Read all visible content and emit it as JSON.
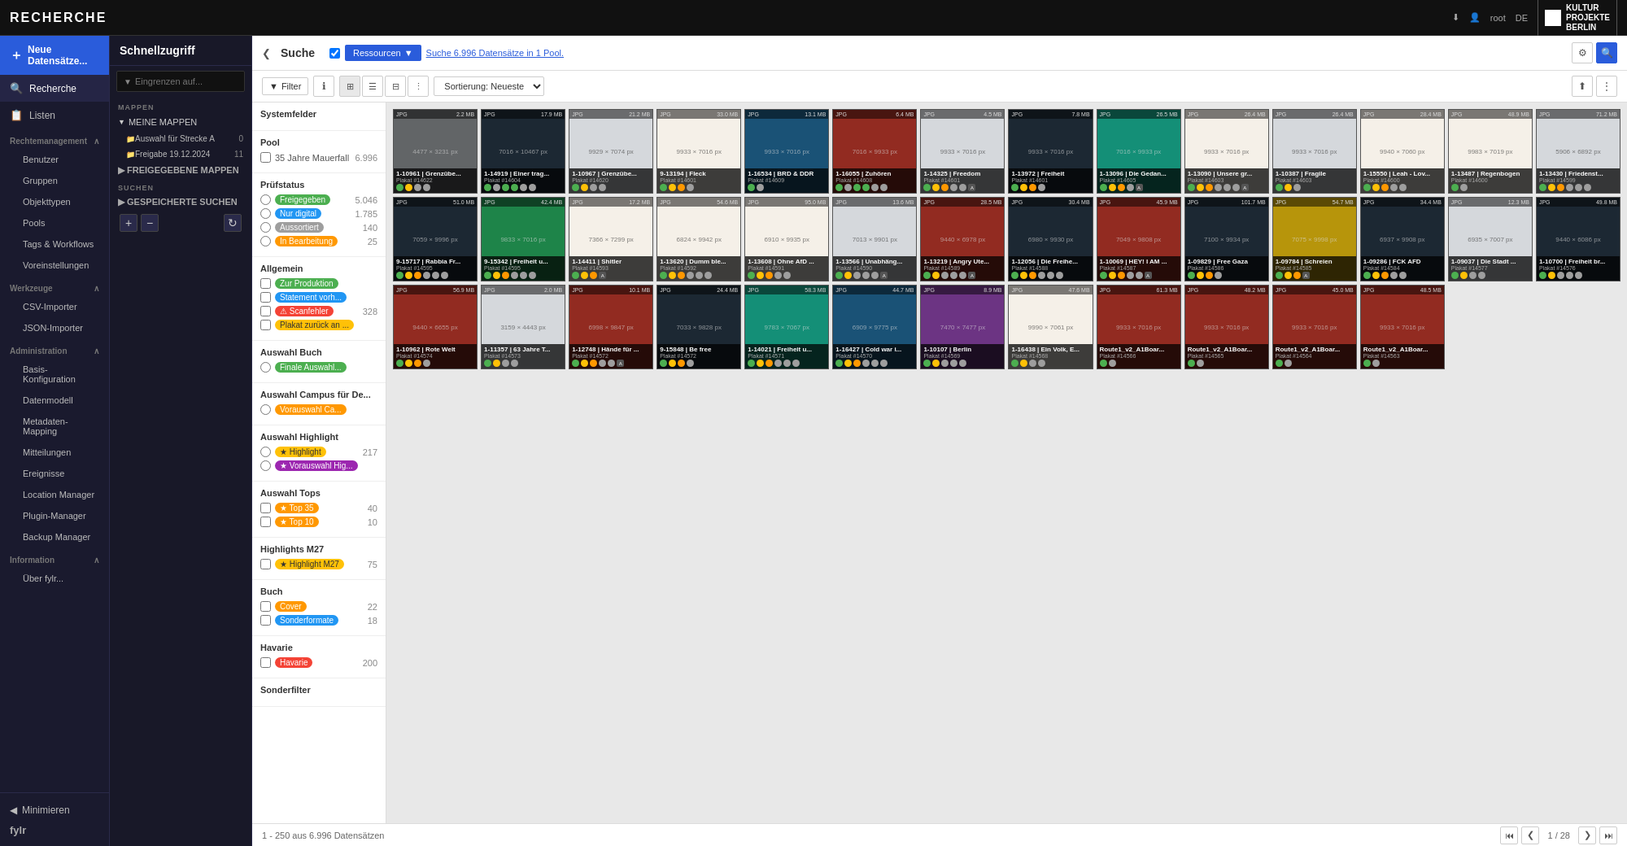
{
  "topbar": {
    "title": "RECHERCHE",
    "user": "root",
    "lang": "DE",
    "logo_line1": "KULTUR",
    "logo_line2": "PROJEKTE",
    "logo_line3": "BERLIN",
    "download_icon": "⬇",
    "user_icon": "👤"
  },
  "sidebar": {
    "new_btn": "Neue Datensätze...",
    "items": [
      {
        "id": "recherche",
        "label": "Recherche",
        "icon": "🔍",
        "active": true
      },
      {
        "id": "listen",
        "label": "Listen",
        "icon": "📋"
      }
    ],
    "sections": [
      {
        "label": "Rechtemanagement",
        "expanded": true,
        "sub": [
          "Benutzer",
          "Gruppen",
          "Objekttypen",
          "Pools",
          "Tags & Workflows",
          "Voreinstellungen"
        ]
      },
      {
        "label": "Werkzeuge",
        "expanded": true,
        "sub": [
          "CSV-Importer",
          "JSON-Importer"
        ]
      },
      {
        "label": "Administration",
        "expanded": true,
        "sub": [
          "Basis-Konfiguration",
          "Datenmodell",
          "Metadaten-Mapping",
          "Mitteilungen",
          "Ereignisse",
          "Location Manager",
          "Plugin-Manager",
          "Backup Manager"
        ]
      },
      {
        "label": "Information",
        "expanded": true,
        "sub": [
          "Über fylr..."
        ]
      }
    ],
    "minimize": "Minimieren",
    "logo": "fylr"
  },
  "quick_panel": {
    "title": "Schnellzugriff",
    "search_placeholder": "Eingrenzen auf...",
    "sections": {
      "mappen_label": "MAPPEN",
      "meine_mappen": "MEINE MAPPEN",
      "mappen_items": [
        {
          "label": "Auswahl für Strecke A",
          "count": "0"
        },
        {
          "label": "Freigabe 19.12.2024",
          "count": "11"
        }
      ],
      "freigegebene_mappen": "FREIGEGEBENE MAPPEN",
      "suchen_label": "SUCHEN",
      "gespeicherte_suchen": "GESPEICHERTE SUCHEN"
    }
  },
  "search": {
    "collapse_icon": "❮",
    "title": "Suche",
    "ressourcen_label": "Ressourcen",
    "search_info": "Suche 6.996 Datensätze in 1 Pool.",
    "filter_label": "Filter",
    "sort_label": "Sortierung: Neueste",
    "view_modes": [
      "⊞",
      "☰",
      "⊟",
      "⋮"
    ],
    "result_count": "1 - 250 aus 6.996 Datensätzen",
    "page": "1 / 28"
  },
  "filter_panel": {
    "system_fields": "Systemfelder",
    "pool_label": "Pool",
    "pool_item": "35 Jahre Mauerfall",
    "pool_count": "6.996",
    "pruefstatus_label": "Prüfstatus",
    "pruefstatus_items": [
      {
        "label": "Freigegeben",
        "color": "green",
        "count": "5.046"
      },
      {
        "label": "Nur digital",
        "color": "blue",
        "count": "1.785"
      },
      {
        "label": "Aussortiert",
        "color": "gray",
        "count": "140"
      },
      {
        "label": "In Bearbeitung",
        "color": "orange",
        "count": "25"
      }
    ],
    "allgemein_label": "Allgemein",
    "allgemein_items": [
      {
        "label": "Zur Produktion",
        "color": "green"
      },
      {
        "label": "Statement vorh...",
        "color": "blue"
      },
      {
        "label": "Scanfehler",
        "color": "red",
        "count": "328"
      },
      {
        "label": "Plakat zurück an ...",
        "color": "yellow"
      }
    ],
    "auswahl_buch_label": "Auswahl Buch",
    "auswahl_buch_items": [
      {
        "label": "Finale Auswahl...",
        "color": "green"
      }
    ],
    "auswahl_campus_label": "Auswahl Campus für De...",
    "auswahl_campus_items": [
      {
        "label": "Vorauswahl Ca...",
        "color": "orange"
      }
    ],
    "auswahl_highlight_label": "Auswahl Highlight",
    "auswahl_highlight_items": [
      {
        "label": "Highlight",
        "color": "yellow",
        "count": "217"
      },
      {
        "label": "Vorauswahl Hig...",
        "color": "purple"
      }
    ],
    "auswahl_tops_label": "Auswahl Tops",
    "auswahl_tops_items": [
      {
        "label": "Top 35",
        "color": "orange",
        "count": "40"
      },
      {
        "label": "Top 10",
        "color": "orange",
        "count": "10"
      }
    ],
    "highlights_m27_label": "Highlights M27",
    "highlights_m27_items": [
      {
        "label": "Highlight M27",
        "color": "yellow",
        "count": "75"
      }
    ],
    "buch_label": "Buch",
    "buch_items": [
      {
        "label": "Cover",
        "color": "orange",
        "count": "22"
      },
      {
        "label": "Sonderformate",
        "color": "blue",
        "count": "18"
      }
    ],
    "havarie_label": "Havarie",
    "havarie_items": [
      {
        "label": "Havarie",
        "color": "red",
        "count": "200"
      }
    ],
    "sonderfilter_label": "Sonderfilter"
  },
  "grid": {
    "items": [
      {
        "id": "1",
        "type": "JPG",
        "dims": "4477 × 3231 px",
        "size": "2.2 MB",
        "title": "1-10961 | Grenzübe...",
        "plakatNr": "Plakat #14622",
        "bg": "bg-gray",
        "icons": [
          "green",
          "yellow",
          "gray",
          "gray"
        ]
      },
      {
        "id": "2",
        "type": "JPG",
        "dims": "7016 × 10467 px",
        "size": "17.9 MB",
        "title": "1-14919 | Einer trag...",
        "plakatNr": "Plakat #14604",
        "bg": "bg-dark",
        "icons": [
          "green",
          "gray",
          "green",
          "green",
          "gray",
          "gray"
        ]
      },
      {
        "id": "3",
        "type": "JPG",
        "dims": "9929 × 7074 px",
        "size": "21.2 MB",
        "title": "1-10967 | Grenzübe...",
        "plakatNr": "Plakat #14620",
        "bg": "bg-light",
        "icons": [
          "green",
          "yellow",
          "gray",
          "gray"
        ]
      },
      {
        "id": "4",
        "type": "JPG",
        "dims": "9933 × 7016 px",
        "size": "33.0 MB",
        "title": "9-13194 | Fleck",
        "plakatNr": "Plakat #14601",
        "bg": "bg-cream",
        "icons": [
          "green",
          "yellow",
          "orange",
          "gray"
        ]
      },
      {
        "id": "5",
        "type": "JPG",
        "dims": "9933 × 7016 px",
        "size": "13.1 MB",
        "title": "1-16534 | BRD & DDR",
        "plakatNr": "Plakat #14609",
        "bg": "bg-blue",
        "icons": [
          "green",
          "gray"
        ]
      },
      {
        "id": "6",
        "type": "JPG",
        "dims": "7016 × 9933 px",
        "size": "6.4 MB",
        "title": "1-16055 | Zuhören",
        "plakatNr": "Plakat #14608",
        "bg": "bg-red",
        "icons": [
          "green",
          "gray",
          "green",
          "green",
          "gray",
          "gray"
        ]
      },
      {
        "id": "7",
        "type": "JPG",
        "dims": "9933 × 7016 px",
        "size": "4.5 MB",
        "title": "1-14325 | Freedom",
        "plakatNr": "Plakat #14601",
        "bg": "bg-light",
        "icons": [
          "green",
          "yellow",
          "orange",
          "gray",
          "gray",
          "a"
        ]
      },
      {
        "id": "8",
        "type": "JPG",
        "dims": "9933 × 7016 px",
        "size": "7.8 MB",
        "title": "1-13972 | Freiheit",
        "plakatNr": "Plakat #14601",
        "bg": "bg-dark",
        "icons": [
          "green",
          "yellow",
          "orange",
          "gray"
        ]
      },
      {
        "id": "9",
        "type": "JPG",
        "dims": "7016 × 9933 px",
        "size": "26.5 MB",
        "title": "1-13096 | Die Gedan...",
        "plakatNr": "Plakat #14605",
        "bg": "bg-teal",
        "icons": [
          "green",
          "yellow",
          "orange",
          "gray",
          "a"
        ]
      },
      {
        "id": "10",
        "type": "JPG",
        "dims": "9933 × 7016 px",
        "size": "26.4 MB",
        "title": "1-13090 | Unsere gr...",
        "plakatNr": "Plakat #14603",
        "bg": "bg-cream",
        "icons": [
          "green",
          "yellow",
          "orange",
          "gray",
          "gray",
          "gray",
          "a"
        ]
      },
      {
        "id": "11",
        "type": "JPG",
        "dims": "9933 × 7016 px",
        "size": "26.4 MB",
        "title": "1-10387 | Fragile",
        "plakatNr": "Plakat #14603",
        "bg": "bg-light",
        "icons": [
          "green",
          "yellow",
          "gray"
        ]
      },
      {
        "id": "12",
        "type": "JPG",
        "dims": "9940 × 7060 px",
        "size": "28.4 MB",
        "title": "1-15550 | Leah - Lov...",
        "plakatNr": "Plakat #14600",
        "bg": "bg-cream",
        "icons": [
          "green",
          "yellow",
          "orange",
          "gray",
          "gray"
        ]
      },
      {
        "id": "13",
        "type": "JPG",
        "dims": "9983 × 7019 px",
        "size": "48.9 MB",
        "title": "1-13487 | Regenbogen",
        "plakatNr": "Plakat #14600",
        "bg": "bg-cream",
        "icons": [
          "green",
          "gray"
        ]
      },
      {
        "id": "14",
        "type": "JPG",
        "dims": "5906 × 6892 px",
        "size": "71.2 MB",
        "title": "1-13430 | Friedenst...",
        "plakatNr": "Plakat #14599",
        "bg": "bg-light",
        "icons": [
          "green",
          "yellow",
          "orange",
          "gray",
          "gray",
          "gray"
        ]
      },
      {
        "id": "15",
        "type": "JPG",
        "dims": "7059 × 9996 px",
        "size": "51.0 MB",
        "title": "9-15717 | Rabbia Fr...",
        "plakatNr": "Plakat #14595",
        "bg": "bg-dark",
        "icons": [
          "green",
          "yellow",
          "orange",
          "gray",
          "gray",
          "gray"
        ]
      },
      {
        "id": "16",
        "type": "JPG",
        "dims": "9833 × 7016 px",
        "size": "42.4 MB",
        "title": "9-15342 | Freiheit u...",
        "plakatNr": "Plakat #14595",
        "bg": "bg-green",
        "icons": [
          "green",
          "yellow",
          "orange",
          "gray",
          "gray",
          "gray"
        ]
      },
      {
        "id": "17",
        "type": "JPG",
        "dims": "7366 × 7299 px",
        "size": "17.2 MB",
        "title": "1-14411 | Shitler",
        "plakatNr": "Plakat #14593",
        "bg": "bg-cream",
        "icons": [
          "green",
          "yellow",
          "orange",
          "a"
        ]
      },
      {
        "id": "18",
        "type": "JPG",
        "dims": "6824 × 9942 px",
        "size": "54.6 MB",
        "title": "1-13620 | Dumm ble...",
        "plakatNr": "Plakat #14592",
        "bg": "bg-cream",
        "icons": [
          "green",
          "yellow",
          "orange",
          "gray",
          "gray",
          "gray"
        ]
      },
      {
        "id": "19",
        "type": "JPG",
        "dims": "6910 × 9935 px",
        "size": "95.0 MB",
        "title": "1-13608 | Ohne AfD ...",
        "plakatNr": "Plakat #14591",
        "bg": "bg-cream",
        "icons": [
          "green",
          "yellow",
          "orange",
          "gray",
          "gray"
        ]
      },
      {
        "id": "20",
        "type": "JPG",
        "dims": "7013 × 9901 px",
        "size": "13.6 MB",
        "title": "1-13566 | Unabhäng...",
        "plakatNr": "Plakat #14590",
        "bg": "bg-light",
        "icons": [
          "green",
          "yellow",
          "gray",
          "gray",
          "gray",
          "a"
        ]
      },
      {
        "id": "21",
        "type": "JPG",
        "dims": "9440 × 6978 px",
        "size": "28.5 MB",
        "title": "1-13219 | Angry Ute...",
        "plakatNr": "Plakat #14589",
        "bg": "bg-red",
        "icons": [
          "green",
          "yellow",
          "gray",
          "gray",
          "gray",
          "a"
        ]
      },
      {
        "id": "22",
        "type": "JPG",
        "dims": "6980 × 9930 px",
        "size": "30.4 MB",
        "title": "1-12056 | Die Freihe...",
        "plakatNr": "Plakat #14588",
        "bg": "bg-dark",
        "icons": [
          "green",
          "yellow",
          "orange",
          "gray",
          "gray",
          "gray"
        ]
      },
      {
        "id": "23",
        "type": "JPG",
        "dims": "7049 × 9808 px",
        "size": "45.9 MB",
        "title": "1-10069 | HEY! I AM ...",
        "plakatNr": "Plakat #14587",
        "bg": "bg-red",
        "icons": [
          "green",
          "yellow",
          "orange",
          "gray",
          "gray",
          "a"
        ]
      },
      {
        "id": "24",
        "type": "JPG",
        "dims": "7100 × 9934 px",
        "size": "101.7 MB",
        "title": "1-09829 | Free Gaza",
        "plakatNr": "Plakat #14586",
        "bg": "bg-dark",
        "icons": [
          "green",
          "yellow",
          "orange",
          "gray"
        ]
      },
      {
        "id": "25",
        "type": "JPG",
        "dims": "7075 × 9998 px",
        "size": "54.7 MB",
        "title": "1-09784 | Schreien",
        "plakatNr": "Plakat #14585",
        "bg": "bg-yellow",
        "icons": [
          "green",
          "yellow",
          "orange",
          "a"
        ]
      },
      {
        "id": "26",
        "type": "JPG",
        "dims": "6937 × 9908 px",
        "size": "34.4 MB",
        "title": "1-09286 | FCK AFD",
        "plakatNr": "Plakat #14584",
        "bg": "bg-dark",
        "icons": [
          "green",
          "yellow",
          "orange",
          "gray",
          "gray"
        ]
      },
      {
        "id": "27",
        "type": "JPG",
        "dims": "6935 × 7007 px",
        "size": "12.3 MB",
        "title": "1-09037 | Die Stadt ...",
        "plakatNr": "Plakat #14577",
        "bg": "bg-light",
        "icons": [
          "green",
          "yellow",
          "gray",
          "gray"
        ]
      },
      {
        "id": "28",
        "type": "JPG",
        "dims": "9440 × 6086 px",
        "size": "49.8 MB",
        "title": "1-10700 | Freiheit br...",
        "plakatNr": "Plakat #14576",
        "bg": "bg-dark",
        "icons": [
          "green",
          "yellow",
          "gray",
          "gray",
          "gray"
        ]
      },
      {
        "id": "29",
        "type": "JPG",
        "dims": "9440 × 6655 px",
        "size": "56.9 MB",
        "title": "1-10962 | Rote Welt",
        "plakatNr": "Plakat #14574",
        "bg": "bg-red",
        "icons": [
          "green",
          "yellow",
          "orange",
          "gray"
        ]
      },
      {
        "id": "30",
        "type": "JPG",
        "dims": "3159 × 4443 px",
        "size": "2.0 MB",
        "title": "1-11357 | 63 Jahre T...",
        "plakatNr": "Plakat #14573",
        "bg": "bg-light",
        "icons": [
          "green",
          "yellow",
          "gray",
          "gray"
        ]
      },
      {
        "id": "31",
        "type": "JPG",
        "dims": "6998 × 9847 px",
        "size": "10.1 MB",
        "title": "1-12748 | Hände für ...",
        "plakatNr": "Plakat #14572",
        "bg": "bg-red",
        "icons": [
          "green",
          "yellow",
          "orange",
          "gray",
          "gray",
          "a"
        ]
      },
      {
        "id": "32",
        "type": "JPG",
        "dims": "7033 × 9828 px",
        "size": "24.4 MB",
        "title": "9-15848 | Be free",
        "plakatNr": "Plakat #14572",
        "bg": "bg-dark",
        "icons": [
          "green",
          "yellow",
          "orange",
          "gray"
        ]
      },
      {
        "id": "33",
        "type": "JPG",
        "dims": "9783 × 7067 px",
        "size": "58.3 MB",
        "title": "1-14021 | Freiheit u...",
        "plakatNr": "Plakat #14571",
        "bg": "bg-teal",
        "icons": [
          "green",
          "yellow",
          "orange",
          "gray",
          "gray",
          "gray"
        ]
      },
      {
        "id": "34",
        "type": "JPG",
        "dims": "6909 × 9775 px",
        "size": "44.7 MB",
        "title": "1-16427 | Cold war i...",
        "plakatNr": "Plakat #14570",
        "bg": "bg-blue",
        "icons": [
          "green",
          "yellow",
          "orange",
          "gray",
          "gray",
          "gray"
        ]
      },
      {
        "id": "35",
        "type": "JPG",
        "dims": "7470 × 7477 px",
        "size": "8.9 MB",
        "title": "1-10107 | Berlin",
        "plakatNr": "Plakat #14569",
        "bg": "bg-purple",
        "icons": [
          "green",
          "yellow",
          "gray",
          "gray",
          "gray"
        ]
      },
      {
        "id": "36",
        "type": "JPG",
        "dims": "9990 × 7061 px",
        "size": "47.6 MB",
        "title": "1-16438 | Ein Volk, E...",
        "plakatNr": "Plakat #14568",
        "bg": "bg-cream",
        "icons": [
          "green",
          "yellow",
          "gray",
          "gray"
        ]
      },
      {
        "id": "37",
        "type": "JPG",
        "dims": "9933 × 7016 px",
        "size": "61.3 MB",
        "title": "Route1_v2_A1Boar...",
        "plakatNr": "Plakat #14566",
        "bg": "bg-red",
        "icons": [
          "green",
          "gray"
        ]
      },
      {
        "id": "38",
        "type": "JPG",
        "dims": "9933 × 7016 px",
        "size": "48.2 MB",
        "title": "Route1_v2_A1Boar...",
        "plakatNr": "Plakat #14565",
        "bg": "bg-red",
        "icons": [
          "green",
          "gray"
        ]
      },
      {
        "id": "39",
        "type": "JPG",
        "dims": "9933 × 7016 px",
        "size": "45.0 MB",
        "title": "Route1_v2_A1Boar...",
        "plakatNr": "Plakat #14564",
        "bg": "bg-red",
        "icons": [
          "green",
          "gray"
        ]
      },
      {
        "id": "40",
        "type": "JPG",
        "dims": "9933 × 7016 px",
        "size": "48.5 MB",
        "title": "Route1_v2_A1Boar...",
        "plakatNr": "Plakat #14563",
        "bg": "bg-red",
        "icons": [
          "green",
          "gray"
        ]
      }
    ]
  },
  "bottom": {
    "result_text": "1 - 250 aus 6.996 Datensätzen",
    "first": "⏮",
    "prev": "❮",
    "page": "1 / 28",
    "next": "❯",
    "last": "⏭"
  }
}
